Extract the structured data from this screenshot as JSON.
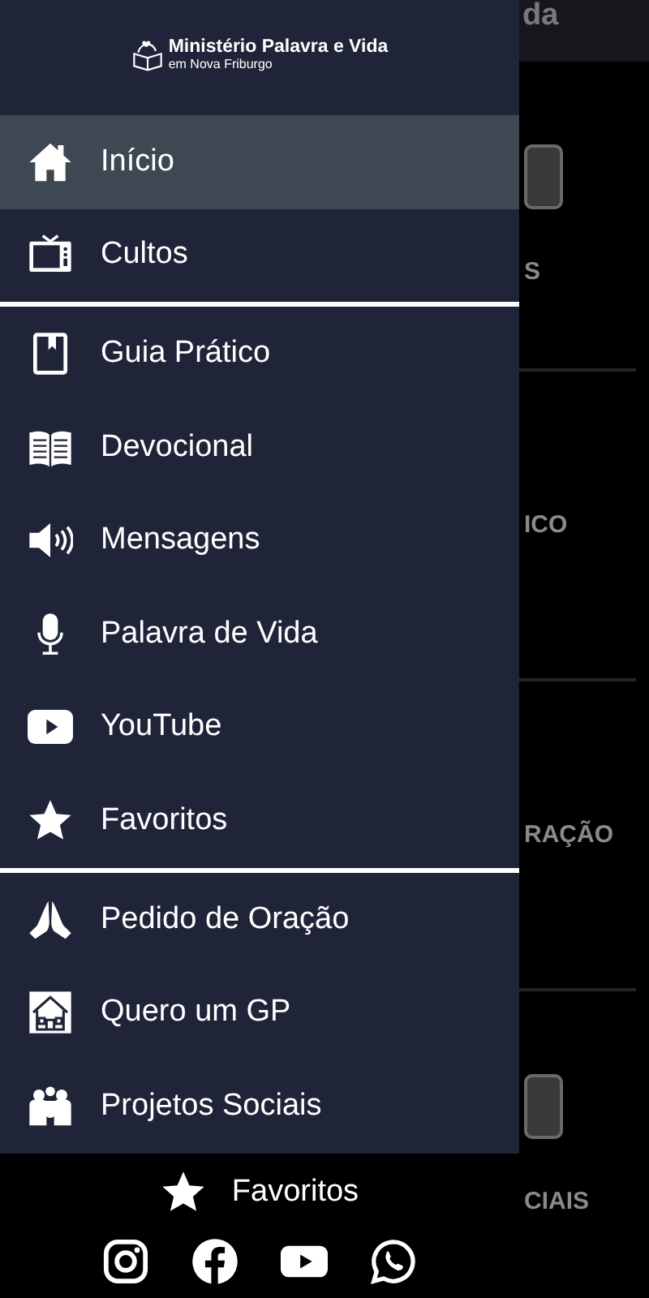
{
  "drawer": {
    "logo": {
      "title": "Ministério Palavra e Vida",
      "subtitle": "em Nova Friburgo"
    },
    "sections": [
      {
        "items": [
          {
            "label": "Início",
            "selected": true
          },
          {
            "label": "Cultos",
            "selected": false
          }
        ]
      },
      {
        "items": [
          {
            "label": "Guia Prático",
            "selected": false
          },
          {
            "label": "Devocional",
            "selected": false
          },
          {
            "label": "Mensagens",
            "selected": false
          },
          {
            "label": "Palavra de Vida",
            "selected": false
          },
          {
            "label": "YouTube",
            "selected": false
          },
          {
            "label": "Favoritos",
            "selected": false
          }
        ]
      },
      {
        "items": [
          {
            "label": "Pedido de Oração",
            "selected": false
          },
          {
            "label": "Quero um GP",
            "selected": false
          },
          {
            "label": "Projetos Sociais",
            "selected": false
          }
        ]
      }
    ],
    "footer": {
      "favorites": "Favoritos"
    }
  },
  "background": {
    "header_title": "da",
    "cards": [
      {
        "label": "S"
      },
      {
        "label": "ICO"
      },
      {
        "label": "RAÇÃO"
      },
      {
        "label": "CIAIS"
      }
    ]
  }
}
